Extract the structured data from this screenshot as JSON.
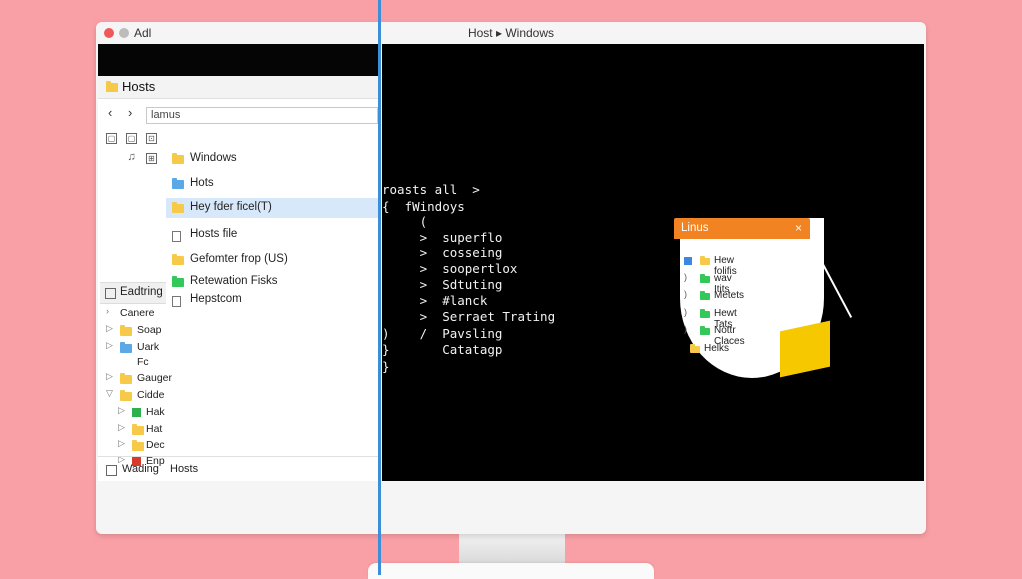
{
  "window": {
    "app_name": "Adl",
    "title": "Host ▸ Windows"
  },
  "finder": {
    "title": "Hosts",
    "nav": {
      "back": "‹",
      "forward": "›"
    },
    "search_value": "lamus",
    "toolbar_glyphs": [
      "▢",
      "▢",
      "⊡",
      "♫",
      "⊞"
    ],
    "items": [
      {
        "label": "Windows",
        "icon": "folder-icon",
        "selected": false
      },
      {
        "label": "Hots",
        "icon": "blue-folder-icon",
        "selected": false
      },
      {
        "label": "Hey fder ficel(T)",
        "icon": "folder-icon",
        "selected": true
      },
      {
        "label": "Hosts file",
        "icon": "file-icon",
        "selected": false
      },
      {
        "label": "Gefomter frop (US)",
        "icon": "folder-icon",
        "selected": false
      },
      {
        "label": "Retewation Fisks",
        "icon": "green-folder-icon",
        "selected": false
      },
      {
        "label": "Hepstcom",
        "icon": "file-icon",
        "selected": false
      }
    ],
    "section_label": "Eadtring",
    "tree": [
      {
        "label": "Canere",
        "arrow": "›",
        "icon": "none"
      },
      {
        "label": "Soap",
        "arrow": "▷",
        "icon": "folder-icon"
      },
      {
        "label": "Uark",
        "arrow": "▷",
        "icon": "blue-folder-icon"
      },
      {
        "label": "Fc",
        "arrow": "",
        "icon": "none"
      },
      {
        "label": "Gauger",
        "arrow": "▷",
        "icon": "folder-icon"
      },
      {
        "label": "Cidde",
        "arrow": "▽",
        "icon": "folder-icon"
      },
      {
        "label": "Hak",
        "arrow": "▷",
        "icon": "green-square-icon"
      },
      {
        "label": "Hat",
        "arrow": "▷",
        "icon": "folder-icon"
      },
      {
        "label": "Dec",
        "arrow": "▷",
        "icon": "folder-icon"
      },
      {
        "label": "Enp",
        "arrow": "▷",
        "icon": "red-square-icon"
      }
    ],
    "status": {
      "left": "Wading",
      "right": "Hosts"
    }
  },
  "terminal": {
    "lines": [
      "roasts all  >",
      "{  fWindoys",
      "     (",
      "     >  superflo",
      "     >  cosseing",
      "     >  soopertlox",
      "     >  Sdtuting",
      "     >  #lanck",
      "     >  Serraet Trating",
      ")    /  Pavsling",
      "}       Catatagp",
      "}"
    ]
  },
  "popup": {
    "title": "Linus",
    "close": "×",
    "items": [
      {
        "label": "Hew folifis",
        "marker": "■"
      },
      {
        "label": "wav Itits",
        "marker": ")"
      },
      {
        "label": "Metets",
        "marker": ")"
      },
      {
        "label": "Hewt Tats",
        "marker": ")"
      },
      {
        "label": "Nottr Claces",
        "marker": ")"
      },
      {
        "label": "Helks",
        "marker": "■"
      }
    ]
  },
  "colors": {
    "background": "#f9a0a6",
    "accent_orange": "#f28322",
    "selection": "#d8e8fb",
    "divider": "#3a8fd8"
  }
}
